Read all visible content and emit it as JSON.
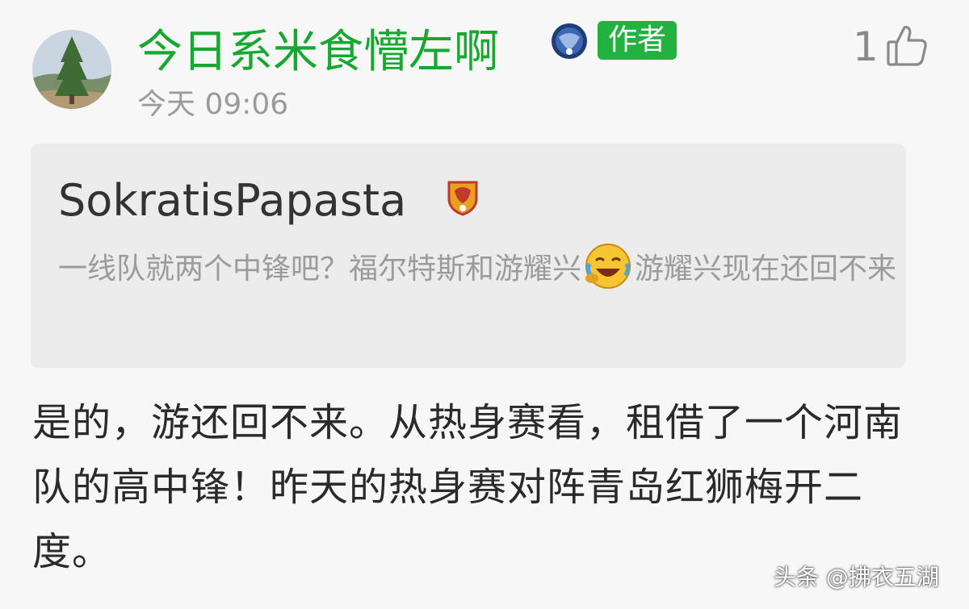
{
  "comment": {
    "username": "今日系米食懵左啊",
    "author_tag": "作者",
    "timestamp": "今天 09:06",
    "like_count": "1",
    "quote": {
      "username": "SokratisPapasta",
      "text_part1": "一线队就两个中锋吧？福尔特斯和游耀兴",
      "text_part2": "游耀兴现在还回不来"
    },
    "reply_text": "是的，游还回不来。从热身赛看，租借了一个河南队的高中锋！昨天的热身赛对阵青岛红狮梅开二度。"
  },
  "watermark": "头条 @拂衣五湖",
  "icons": {
    "like": "thumbs-up-icon",
    "club_badge": "club-badge-icon",
    "quoted_badge": "club-badge-icon",
    "emoji": "laughing-crying-emoji-icon"
  },
  "colors": {
    "username": "#18a832",
    "author_tag": "#21b23f",
    "quote_background": "#ececec"
  }
}
